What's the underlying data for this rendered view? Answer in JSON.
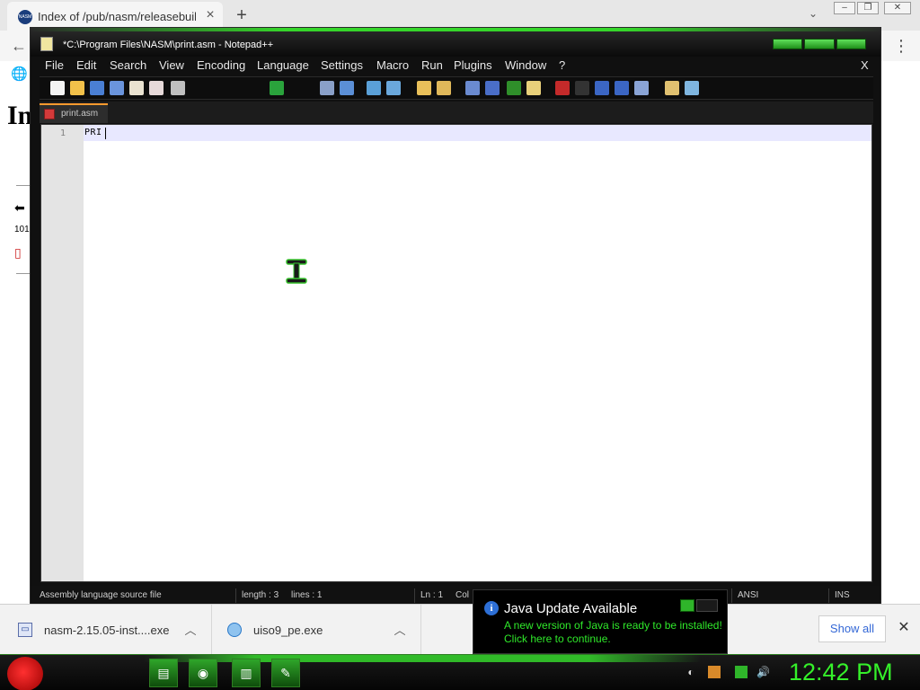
{
  "browser": {
    "tab_title": "Index of /pub/nasm/releasebuilds",
    "tab_close": "×",
    "new_tab": "+",
    "tab_overflow": "⌄",
    "window_controls": [
      "–",
      "❐",
      "✕"
    ],
    "back": "←",
    "menu": "⋮",
    "page_heading": "In"
  },
  "notepadpp": {
    "title": "*C:\\Program Files\\NASM\\print.asm - Notepad++",
    "menu": [
      "File",
      "Edit",
      "Search",
      "View",
      "Encoding",
      "Language",
      "Settings",
      "Macro",
      "Run",
      "Plugins",
      "Window",
      "?"
    ],
    "close_doc": "X",
    "tab_label": "print.asm",
    "line_number": "1",
    "editor_text": "PRI",
    "status": {
      "file_type": "Assembly language source file",
      "length": "length : 3",
      "lines": "lines : 1",
      "ln": "Ln : 1",
      "col": "Col",
      "encoding": "ANSI",
      "mode": "INS"
    }
  },
  "java_notification": {
    "title": "Java Update Available",
    "line1": "A new version of Java is ready to be installed!",
    "line2": "Click here to continue."
  },
  "downloads": {
    "items": [
      {
        "name": "nasm-2.15.05-inst....exe",
        "icon": "installer-icon"
      },
      {
        "name": "uiso9_pe.exe",
        "icon": "ultraiso-icon"
      }
    ],
    "show_all": "Show all",
    "close": "✕"
  },
  "taskbar": {
    "clock": "12:42 PM",
    "pinned": [
      "folder-icon",
      "chrome-icon",
      "notepad-icon",
      "notepadpp-icon"
    ]
  },
  "colors": {
    "theme_green": "#36d62b",
    "clock_green": "#35f02a",
    "tab_accent": "#ff9a2e",
    "current_line": "#e8e8ff"
  }
}
